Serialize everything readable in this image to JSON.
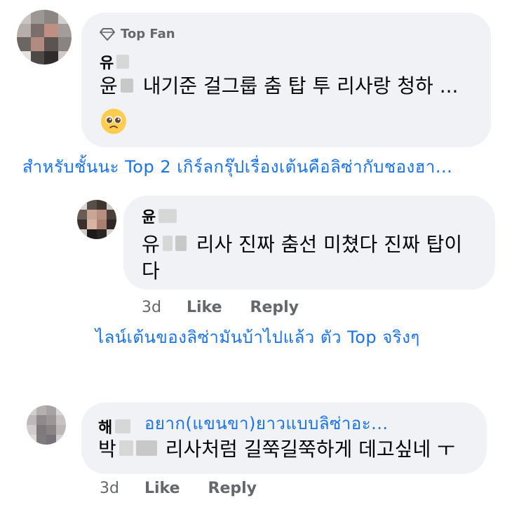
{
  "comments": [
    {
      "badge": "Top Fan",
      "name": "유",
      "line1_prefix": "윤",
      "line1_text": "내기준 걸그룹 춤 탑 투 리사랑 청하 ...",
      "emoji": "pleading-face"
    },
    {
      "name": "윤",
      "line1_prefix": "유",
      "line1_text": "리사 진짜 춤선 미쳤다  진짜 탑이",
      "line2": "다",
      "time": "3d",
      "like": "Like",
      "reply": "Reply"
    },
    {
      "name": "해",
      "line1_prefix": "박",
      "line1_text": "리사처럼 길쭉길쭉하게 데고싶네 ㅜ",
      "time": "3d",
      "like": "Like",
      "reply": "Reply"
    }
  ],
  "overlays": {
    "caption1": "สำหรับชั้นนะ Top 2 เกิร์ลกรุ๊ปเรื่องเต้นคือลิซ่ากับชองฮา...",
    "caption2": "ไลน์เต้นของลิซ่ามันบ้าไปแล้ว ตัว Top จริงๆ",
    "caption3": "อยาก(แขนขา)ยาวแบบลิซ่าอะ..."
  },
  "colors": {
    "bubble": "#f0f2f5",
    "overlay_text": "#1a73e8",
    "meta_text": "#65676b"
  }
}
